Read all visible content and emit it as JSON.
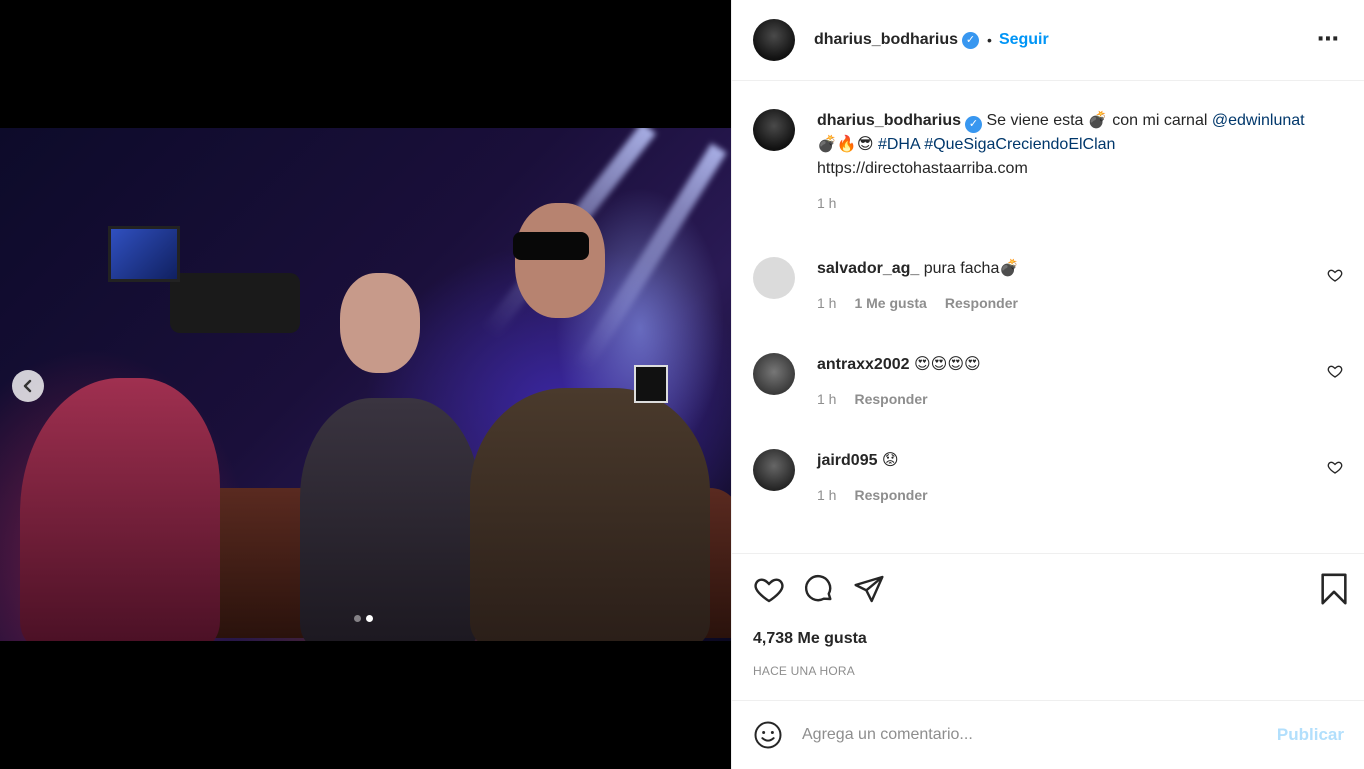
{
  "post": {
    "username": "dharius_bodharius",
    "verified_mark": "✓",
    "bullet": "•",
    "follow_label": "Seguir",
    "more_icon": "⋯",
    "carousel": {
      "prev_icon": "chevron-left-icon",
      "slides": 2,
      "active_slide": 2
    }
  },
  "caption": {
    "username": "dharius_bodharius",
    "text_1": " Se viene esta 💣 con mi carnal ",
    "mention": "@edwinlunat",
    "text_2": "💣🔥😎 ",
    "hashtag_1": "#DHA",
    "hashtag_2": "#QueSigaCreciendoElClan",
    "url": "https://directohastaarriba.com",
    "time": "1 h"
  },
  "comments": [
    {
      "username": "salvador_ag_",
      "text": " pura facha💣",
      "time": "1 h",
      "likes": "1 Me gusta",
      "reply": "Responder"
    },
    {
      "username": "antraxx2002",
      "text": " 😍😍😍😍",
      "time": "1 h",
      "reply": "Responder"
    },
    {
      "username": "jaird095",
      "text": " 😟",
      "time": "1 h",
      "reply": "Responder"
    }
  ],
  "actions": {
    "like_count": "4,738 Me gusta",
    "time_ago": "HACE UNA HORA"
  },
  "add_comment": {
    "emoji_icon": "smiley-icon",
    "placeholder": "Agrega un comentario...",
    "publish_label": "Publicar"
  },
  "colors": {
    "accent": "#0095f6",
    "verified": "#3897f0",
    "publish_disabled": "#b2dffc",
    "muted": "#8e8e8e"
  }
}
